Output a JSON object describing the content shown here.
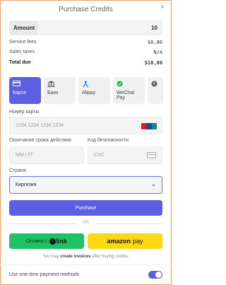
{
  "header": {
    "title": "Purchase Credits",
    "close": "×"
  },
  "amount": {
    "label": "Amount",
    "value": "10"
  },
  "fees": [
    {
      "label": "Service fees",
      "value": "$0,80"
    },
    {
      "label": "Sales taxes",
      "value": "N/A"
    },
    {
      "label": "Total due",
      "value": "$10,80"
    }
  ],
  "methods": [
    {
      "label": "Карта",
      "icon": "credit-card-icon"
    },
    {
      "label": "Банк",
      "icon": "bank-icon"
    },
    {
      "label": "Alipay",
      "icon": "alipay-icon"
    },
    {
      "label": "WeChat Pay",
      "icon": "wechat-icon"
    },
    {
      "label": "",
      "icon": "more-methods-icon"
    }
  ],
  "card": {
    "number_label": "Номер карты",
    "number_placeholder": "1234 1234 1234 1234",
    "expiry_label": "Окончание срока действия",
    "expiry_placeholder": "ММ / ГГ",
    "cvc_label": "Код безопасности",
    "cvc_placeholder": "CVC"
  },
  "country": {
    "label": "Страна",
    "value": "Киргизия"
  },
  "purchase_label": "Purchase",
  "or_label": "OR",
  "link_btn": {
    "prefix": "Оплата с",
    "brand": "link"
  },
  "amazon_btn": {
    "brand_a": "amazon",
    "brand_b": "pay"
  },
  "note": {
    "pre": "You may ",
    "link": "create invoices",
    "post": " after buying credits."
  },
  "toggle_label": "Use one-time payment methods",
  "colors": {
    "accent": "#5b5fe0",
    "link_green": "#1ec164",
    "amazon_yellow": "#ffd814"
  }
}
